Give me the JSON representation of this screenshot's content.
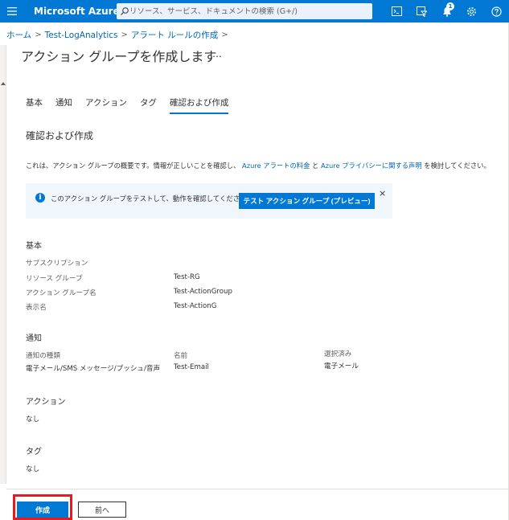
{
  "topbar": {
    "brand": "Microsoft Azure",
    "search_placeholder": "リソース、サービス、ドキュメントの検索 (G+/)",
    "notification_count": "1",
    "accent": "#0078d4"
  },
  "breadcrumb": [
    "ホーム",
    "Test-LogAnalytics",
    "アラート ルールの作成"
  ],
  "page": {
    "title": "アクション グループを作成します",
    "more": "…"
  },
  "tabs": [
    "基本",
    "通知",
    "アクション",
    "タグ",
    "確認および作成"
  ],
  "review": {
    "heading": "確認および作成",
    "summary_prefix": "これは、アクション グループの概要です。情報が正しいことを確認し、",
    "link1": "Azure アラートの料金",
    "and": "と",
    "link2": "Azure プライバシーに関する声明",
    "summary_suffix": "を検討してください。"
  },
  "info": {
    "text": "このアクション グループをテストして、動作を確認してください。",
    "test_button": "テスト アクション グループ (プレビュー)",
    "close": "×"
  },
  "basics": {
    "heading": "基本",
    "subscription_label": "サブスクリプション",
    "subscription_value": "",
    "rg_label": "リソース グループ",
    "rg_value": "Test-RG",
    "ag_name_label": "アクション グループ名",
    "ag_name_value": "Test-ActionGroup",
    "display_label": "表示名",
    "display_value": "Test-ActionG"
  },
  "notifications": {
    "heading": "通知",
    "col_type": "通知の種類",
    "col_name": "名前",
    "col_selected": "選択済み",
    "row_type": "電子メール/SMS メッセージ/プッシュ/音声",
    "row_name": "Test-Email",
    "row_selected": "電子メール"
  },
  "actions": {
    "heading": "アクション",
    "value": "なし"
  },
  "tags": {
    "heading": "タグ",
    "value": "なし"
  },
  "footer": {
    "create_button": "作成",
    "prev_button": "前へ",
    "highlight_color": "#e8191f"
  }
}
